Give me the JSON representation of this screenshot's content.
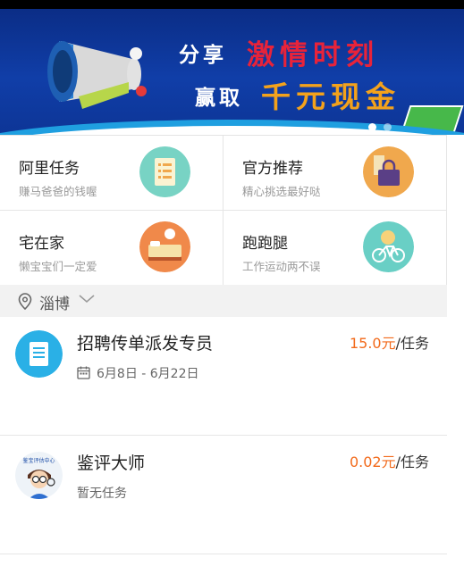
{
  "banner": {
    "line1_a": "分享",
    "line1_b": "激情时刻",
    "line2_a": "赢取",
    "line2_b": "千元现金",
    "colors": {
      "bg": "#103ea8",
      "red": "#e8233a",
      "orange": "#f3a21c"
    }
  },
  "categories": [
    {
      "title": "阿里任务",
      "sub": "赚马爸爸的钱喔",
      "icon": "task-list-icon",
      "color": "#78d3c4"
    },
    {
      "title": "官方推荐",
      "sub": "精心挑选最好哒",
      "icon": "shopping-bag-icon",
      "color": "#f0a84d"
    },
    {
      "title": "宅在家",
      "sub": "懒宝宝们一定爱",
      "icon": "bed-clock-icon",
      "color": "#f0894a"
    },
    {
      "title": "跑跑腿",
      "sub": "工作运动两不误",
      "icon": "bicycle-icon",
      "color": "#69cfc5"
    }
  ],
  "location": {
    "city": "淄博"
  },
  "tasks": [
    {
      "name": "招聘传单派发专员",
      "price": "15.0元",
      "unit": "/任务",
      "meta": "6月8日 - 6月22日"
    },
    {
      "name": "鉴评大师",
      "price": "0.02元",
      "unit": "/任务",
      "meta": "暂无任务",
      "avatar_text": "鉴宝评估中心"
    }
  ]
}
